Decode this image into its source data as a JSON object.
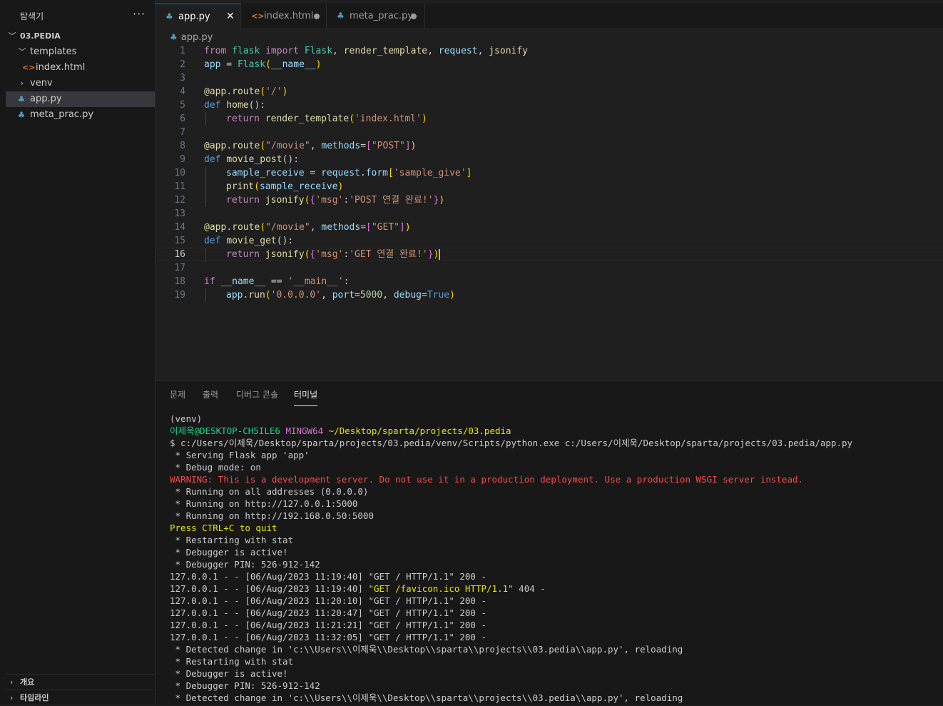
{
  "sidebar": {
    "title": "탐색기",
    "more": "···",
    "root": "03.PEDIA",
    "items": [
      {
        "label": "templates",
        "kind": "folder",
        "expanded": true
      },
      {
        "label": "index.html",
        "kind": "html"
      },
      {
        "label": "venv",
        "kind": "folder",
        "expanded": false
      },
      {
        "label": "app.py",
        "kind": "py",
        "selected": true
      },
      {
        "label": "meta_prac.py",
        "kind": "py"
      }
    ],
    "bottom_sections": [
      "개요",
      "타임라인"
    ]
  },
  "tabs": [
    {
      "label": "app.py",
      "icon": "python-file-icon",
      "active": true,
      "close": "✕"
    },
    {
      "label": "index.html",
      "icon": "html-file-icon",
      "modified": true
    },
    {
      "label": "meta_prac.py",
      "icon": "python-file-icon",
      "modified": true
    }
  ],
  "breadcrumb": {
    "file": "app.py"
  },
  "editor": {
    "current_line": 16,
    "line_numbers": [
      "1",
      "2",
      "3",
      "4",
      "5",
      "6",
      "7",
      "8",
      "9",
      "10",
      "11",
      "12",
      "13",
      "14",
      "15",
      "16",
      "17",
      "18",
      "19"
    ]
  },
  "panel": {
    "tabs": [
      "문제",
      "출력",
      "디버그 콘솔",
      "터미널"
    ],
    "active_tab": "터미널",
    "terminal": {
      "venv": "(venv)",
      "prompt_user": "이제욱@DESKTOP-CH5ILE6",
      "prompt_env": "MINGW64",
      "prompt_path": "~/Desktop/sparta/projects/03.pedia",
      "command": "$ c:/Users/이제욱/Desktop/sparta/projects/03.pedia/venv/Scripts/python.exe c:/Users/이제욱/Desktop/sparta/projects/03.pedia/app.py",
      "lines_before_warning": [
        " * Serving Flask app 'app'",
        " * Debug mode: on"
      ],
      "warning": "WARNING: This is a development server. Do not use it in a production deployment. Use a production WSGI server instead.",
      "running": [
        " * Running on all addresses (0.0.0.0)",
        " * Running on http://127.0.0.1:5000",
        " * Running on http://192.168.0.50:5000"
      ],
      "quit": "Press CTRL+C to quit",
      "debug": [
        " * Restarting with stat",
        " * Debugger is active!",
        " * Debugger PIN: 526-912-142",
        "127.0.0.1 - - [06/Aug/2023 11:19:40] \"GET / HTTP/1.1\" 200 -"
      ],
      "favicon_prefix": "127.0.0.1 - - [06/Aug/2023 11:19:40] ",
      "favicon_request": "\"GET /favicon.ico HTTP/1.1\"",
      "favicon_suffix": " 404 -",
      "after": [
        "127.0.0.1 - - [06/Aug/2023 11:20:10] \"GET / HTTP/1.1\" 200 -",
        "127.0.0.1 - - [06/Aug/2023 11:20:47] \"GET / HTTP/1.1\" 200 -",
        "127.0.0.1 - - [06/Aug/2023 11:21:21] \"GET / HTTP/1.1\" 200 -",
        "127.0.0.1 - - [06/Aug/2023 11:32:05] \"GET / HTTP/1.1\" 200 -",
        " * Detected change in 'c:\\\\Users\\\\이제욱\\\\Desktop\\\\sparta\\\\projects\\\\03.pedia\\\\app.py', reloading",
        " * Restarting with stat",
        " * Debugger is active!",
        " * Debugger PIN: 526-912-142",
        " * Detected change in 'c:\\\\Users\\\\이제욱\\\\Desktop\\\\sparta\\\\projects\\\\03.pedia\\\\app.py', reloading"
      ]
    }
  },
  "colors": {
    "accent": "#0078d4",
    "python_icon": "#519aba",
    "html_icon": "#e37933",
    "terminal_green": "#23d18b",
    "terminal_magenta": "#d670d6",
    "terminal_yellow": "#e5e510",
    "terminal_red": "#f14c4c"
  },
  "code": {
    "l1": [
      "from",
      " ",
      "flask",
      " ",
      "import",
      " ",
      "Flask",
      ", ",
      "render_template",
      ", ",
      "request",
      ", ",
      "jsonify"
    ],
    "l2": [
      "app",
      " = ",
      "Flask",
      "(",
      "__name__",
      ")"
    ],
    "l4": [
      "@",
      "app",
      ".",
      "route",
      "(",
      "'/'",
      ")"
    ],
    "l5": [
      "def",
      " ",
      "home",
      "():"
    ],
    "l6": [
      "return",
      " ",
      "render_template",
      "(",
      "'index.html'",
      ")"
    ],
    "l8": [
      "@",
      "app",
      ".",
      "route",
      "(",
      "\"/movie\"",
      ", ",
      "methods",
      "=",
      "[",
      "\"POST\"",
      "]",
      ")"
    ],
    "l9": [
      "def",
      " ",
      "movie_post",
      "():"
    ],
    "l10": [
      "sample_receive",
      " = ",
      "request",
      ".",
      "form",
      "[",
      "'sample_give'",
      "]"
    ],
    "l11": [
      "print",
      "(",
      "sample_receive",
      ")"
    ],
    "l12": [
      "return",
      " ",
      "jsonify",
      "(",
      "{",
      "'msg'",
      ":",
      "'POST 연결 완료!'",
      "}",
      ")"
    ],
    "l14": [
      "@",
      "app",
      ".",
      "route",
      "(",
      "\"/movie\"",
      ", ",
      "methods",
      "=",
      "[",
      "\"GET\"",
      "]",
      ")"
    ],
    "l15": [
      "def",
      " ",
      "movie_get",
      "():"
    ],
    "l16": [
      "return",
      " ",
      "jsonify",
      "(",
      "{",
      "'msg'",
      ":",
      "'GET 연결 완료!'",
      "}",
      ")"
    ],
    "l18": [
      "if",
      " ",
      "__name__",
      " == ",
      "'__main__'",
      ":"
    ],
    "l19": [
      "app",
      ".",
      "run",
      "(",
      "'0.0.0.0'",
      ", ",
      "port",
      "=",
      "5000",
      ", ",
      "debug",
      "=",
      "True",
      ")"
    ]
  }
}
